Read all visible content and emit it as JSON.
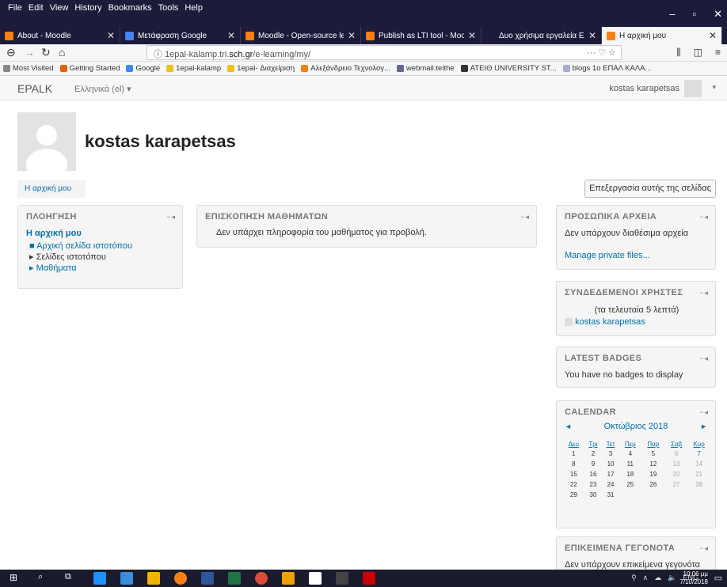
{
  "menubar": {
    "items": [
      "File",
      "Edit",
      "View",
      "History",
      "Bookmarks",
      "Tools",
      "Help"
    ]
  },
  "tabs": [
    {
      "title": "About - Moodle",
      "color": "#f98012"
    },
    {
      "title": "Μετάφραση Google",
      "color": "#4285f4"
    },
    {
      "title": "Moodle - Open-source lear",
      "color": "#f98012"
    },
    {
      "title": "Publish as LTI tool - Moodl",
      "color": "#f98012"
    },
    {
      "title": "Δυο χρήσιμα εργαλεία ΕΛΛΑΚ y",
      "color": "#1d1b3a"
    },
    {
      "title": "Η αρχική μου",
      "color": "#f98012"
    }
  ],
  "url": {
    "prefix": "1epal-kalamp.tri.",
    "domain": "sch.gr",
    "path": "/e-learning/my/",
    "dots": "··· ♡ ☆"
  },
  "bookmarks": [
    {
      "label": "Most Visited",
      "color": "#888"
    },
    {
      "label": "Getting Started",
      "color": "#e66000"
    },
    {
      "label": "Google",
      "color": "#4285f4"
    },
    {
      "label": "1epal-kalamp",
      "color": "#f0c020"
    },
    {
      "label": "1epal- Διαχείριση",
      "color": "#f0c020"
    },
    {
      "label": "Αλεξάνδρειο Τεχνολογ...",
      "color": "#f98012"
    },
    {
      "label": "webmail.teithe",
      "color": "#669"
    },
    {
      "label": "ATEIΘ UNIVERSITY ST...",
      "color": "#333"
    },
    {
      "label": "blogs 1o ΕΠΑΛ ΚΑΛΑ...",
      "color": "#aac"
    }
  ],
  "moodle": {
    "brand": "EPALK",
    "lang": "Ελληνικά (el) ▾",
    "user": "kostas karapetsas"
  },
  "header": {
    "name": "kostas karapetsas",
    "breadcrumb": "Η αρχική μου",
    "edit_button": "Επεξεργασία αυτής της σελίδας"
  },
  "nav_block": {
    "title": "ΠΛΟΗΓΗΣΗ",
    "home": "Η αρχική μου",
    "items": [
      "■ Αρχική σελίδα ιστοτόπου",
      "▸ Σελίδες ιστοτόπου",
      "▸ Μαθήματα"
    ]
  },
  "overview_block": {
    "title": "ΕΠΙΣΚΟΠΗΣΗ ΜΑΘΗΜΑΤΩΝ",
    "text": "Δεν υπάρχει πληροφορία του μαθήματος για προβολή."
  },
  "files_block": {
    "title": "ΠΡΟΣΩΠΙΚΑ ΑΡΧΕΙΑ",
    "text": "Δεν υπάρχουν διαθέσιμα αρχεία",
    "link": "Manage private files..."
  },
  "online_block": {
    "title": "ΣΥΝΔΕΔΕΜΕΝΟΙ ΧΡΗΣΤΕΣ",
    "period": "(τα τελευταία 5 λεπτά)",
    "user": "kostas karapetsas"
  },
  "badges_block": {
    "title": "LATEST BADGES",
    "text": "You have no badges to display"
  },
  "calendar_block": {
    "title": "CALENDAR",
    "month": "Οκτώβριος 2018",
    "prev": "◄",
    "next": "►",
    "days": [
      "Δευ",
      "Τρι",
      "Τετ",
      "Πεμ",
      "Παρ",
      "Σαβ",
      "Κυρ"
    ],
    "weeks": [
      [
        "1",
        "2",
        "3",
        "4",
        "5",
        "6",
        "7"
      ],
      [
        "8",
        "9",
        "10",
        "11",
        "12",
        "13",
        "14"
      ],
      [
        "15",
        "16",
        "17",
        "18",
        "19",
        "20",
        "21"
      ],
      [
        "22",
        "23",
        "24",
        "25",
        "26",
        "27",
        "28"
      ],
      [
        "29",
        "30",
        "31",
        "",
        "",
        "",
        ""
      ]
    ]
  },
  "events_block": {
    "title": "ΕΠΙΚΕΙΜΕΝΑ ΓΕΓΟΝΟΤΑ",
    "text": "Δεν υπάρχουν επικείμενα γεγονότα"
  },
  "taskbar": {
    "lang": "ENG",
    "time": "10:06 μμ",
    "date": "7/10/2018"
  },
  "block_icons": "−◂"
}
